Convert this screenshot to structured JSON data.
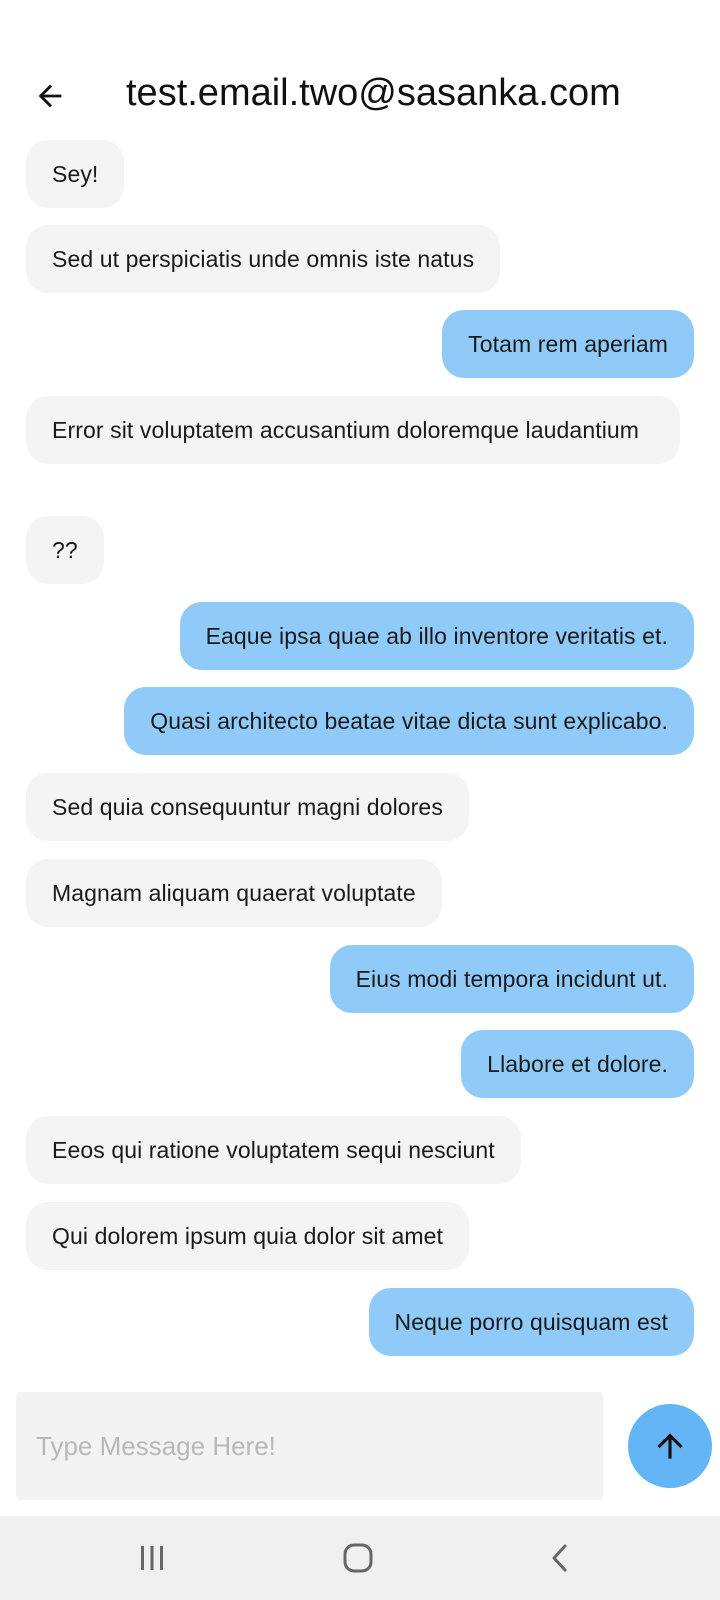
{
  "header": {
    "back_icon": "arrow-left-icon",
    "title": "test.email.two@sasanka.com"
  },
  "messages": [
    {
      "side": "incoming",
      "text": "Sey!"
    },
    {
      "side": "incoming",
      "text": "Sed ut perspiciatis unde omnis iste natus"
    },
    {
      "side": "outgoing",
      "text": "Totam rem aperiam"
    },
    {
      "side": "incoming",
      "text": "Error sit voluptatem accusantium doloremque laudantium"
    },
    {
      "side": "incoming",
      "text": "??"
    },
    {
      "side": "outgoing",
      "text": "Eaque ipsa quae ab illo inventore veritatis et."
    },
    {
      "side": "outgoing",
      "text": "Quasi architecto beatae vitae dicta sunt explicabo."
    },
    {
      "side": "incoming",
      "text": "Sed quia consequuntur magni dolores"
    },
    {
      "side": "incoming",
      "text": "Magnam aliquam quaerat voluptate"
    },
    {
      "side": "outgoing",
      "text": "Eius modi tempora incidunt ut."
    },
    {
      "side": "outgoing",
      "text": "Llabore et dolore."
    },
    {
      "side": "incoming",
      "text": "Eeos qui ratione voluptatem sequi nesciunt"
    },
    {
      "side": "incoming",
      "text": "Qui dolorem ipsum quia dolor sit amet"
    },
    {
      "side": "outgoing",
      "text": "Neque porro quisquam est"
    }
  ],
  "composer": {
    "placeholder": "Type Message Here!",
    "value": "",
    "send_icon": "arrow-up-icon"
  },
  "nav": {
    "recents_icon": "recents-icon",
    "home_icon": "home-icon",
    "back_icon": "back-chevron-icon"
  },
  "colors": {
    "incoming_bubble": "#f4f4f4",
    "outgoing_bubble": "#90caf9",
    "send_button": "#64b5f6",
    "nav_bar": "#f0f0f0"
  }
}
